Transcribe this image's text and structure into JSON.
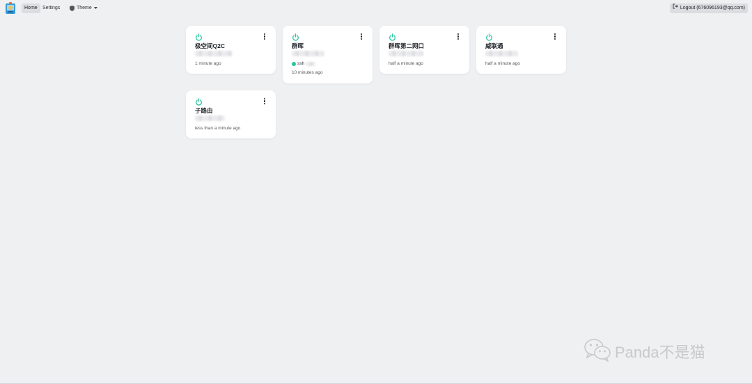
{
  "nav": {
    "home_label": "Home",
    "settings_label": "Settings",
    "theme_label": "Theme",
    "logout_label": "Logout (676096193@qq.com)"
  },
  "colors": {
    "accent": "#2bc4a0",
    "background": "#eff0f2",
    "card": "#ffffff"
  },
  "devices": [
    {
      "name": "极空间Q2C",
      "time": "1 minute ago",
      "status_icon": "power-icon",
      "status_color": "#2bc4a0"
    },
    {
      "name": "群晖",
      "time": "10 minutes ago",
      "status_icon": "power-icon",
      "status_color": "#2bc4a0",
      "service": "ssh"
    },
    {
      "name": "群晖第二网口",
      "time": "half a minute ago",
      "status_icon": "power-icon",
      "status_color": "#2bc4a0"
    },
    {
      "name": "威联通",
      "time": "half a minute ago",
      "status_icon": "power-icon",
      "status_color": "#2bc4a0"
    },
    {
      "name": "子路由",
      "time": "less than a minute ago",
      "status_icon": "power-icon",
      "status_color": "#2bc4a0"
    }
  ],
  "watermark": {
    "text": "Panda不是猫",
    "icon": "wechat-icon"
  }
}
